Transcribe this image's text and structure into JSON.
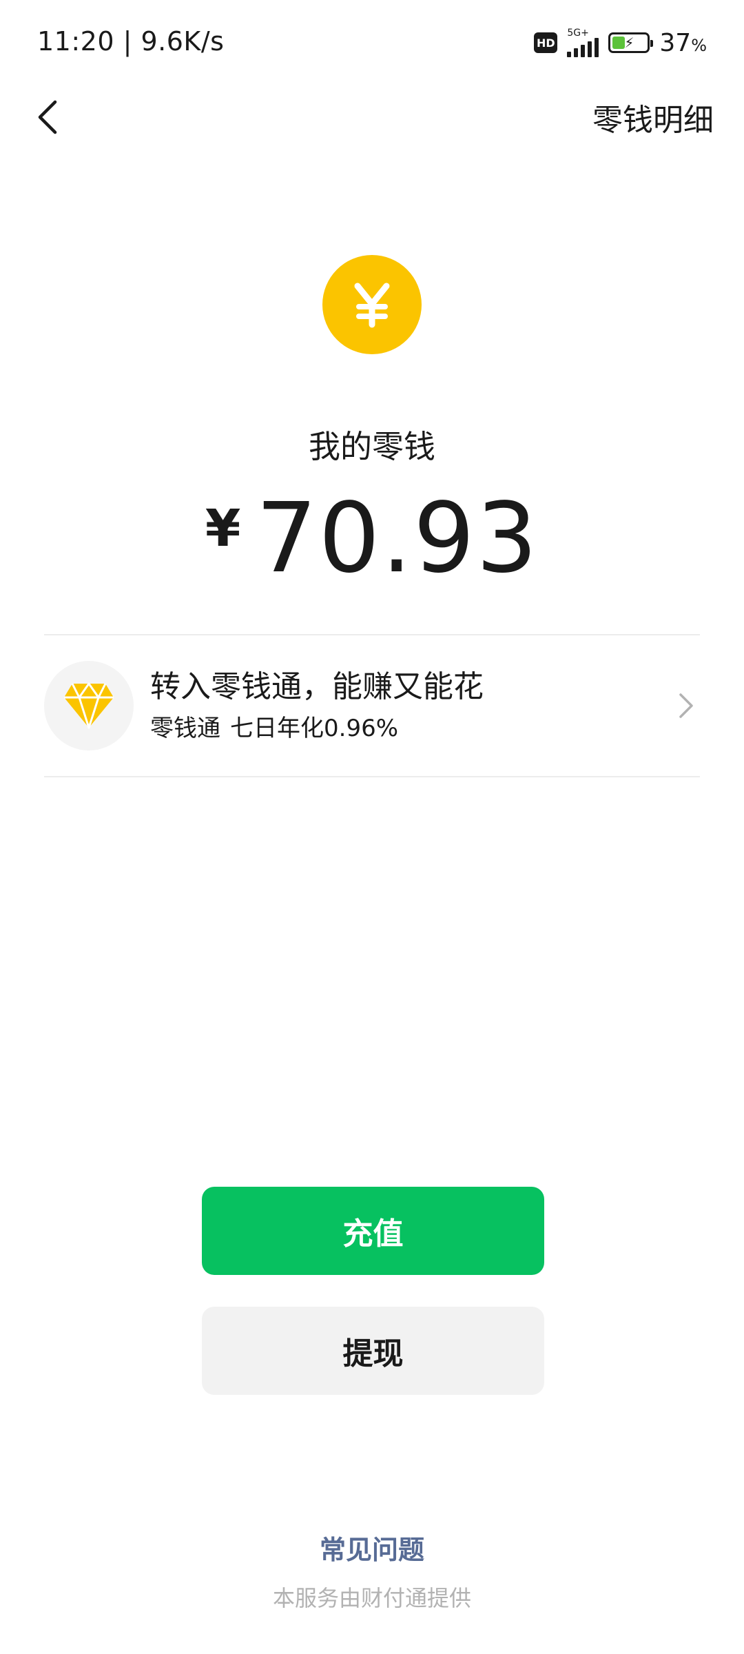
{
  "status_bar": {
    "time": "11:20",
    "speed": "9.6K/s",
    "hd": "HD",
    "network": "5G+",
    "battery_level": 0.37,
    "battery_percent": "37",
    "battery_unit": "%"
  },
  "nav": {
    "back_icon": "chevron-left-icon",
    "details_label": "零钱明细"
  },
  "balance": {
    "coin_icon": "yuan-coin-icon",
    "coin_symbol": "¥",
    "label": "我的零钱",
    "currency": "¥",
    "amount": "70.93"
  },
  "promo": {
    "icon": "diamond-icon",
    "title": "转入零钱通，能赚又能花",
    "product": "零钱通",
    "rate_text": "七日年化0.96%",
    "chevron_icon": "chevron-right-icon"
  },
  "actions": {
    "topup_label": "充值",
    "withdraw_label": "提现"
  },
  "footer": {
    "faq_label": "常见问题",
    "provider_text": "本服务由财付通提供"
  },
  "colors": {
    "primary_green": "#07c160",
    "coin_yellow": "#fbc400",
    "link_blue": "#576b95",
    "muted_gray": "#b2b2b2"
  }
}
